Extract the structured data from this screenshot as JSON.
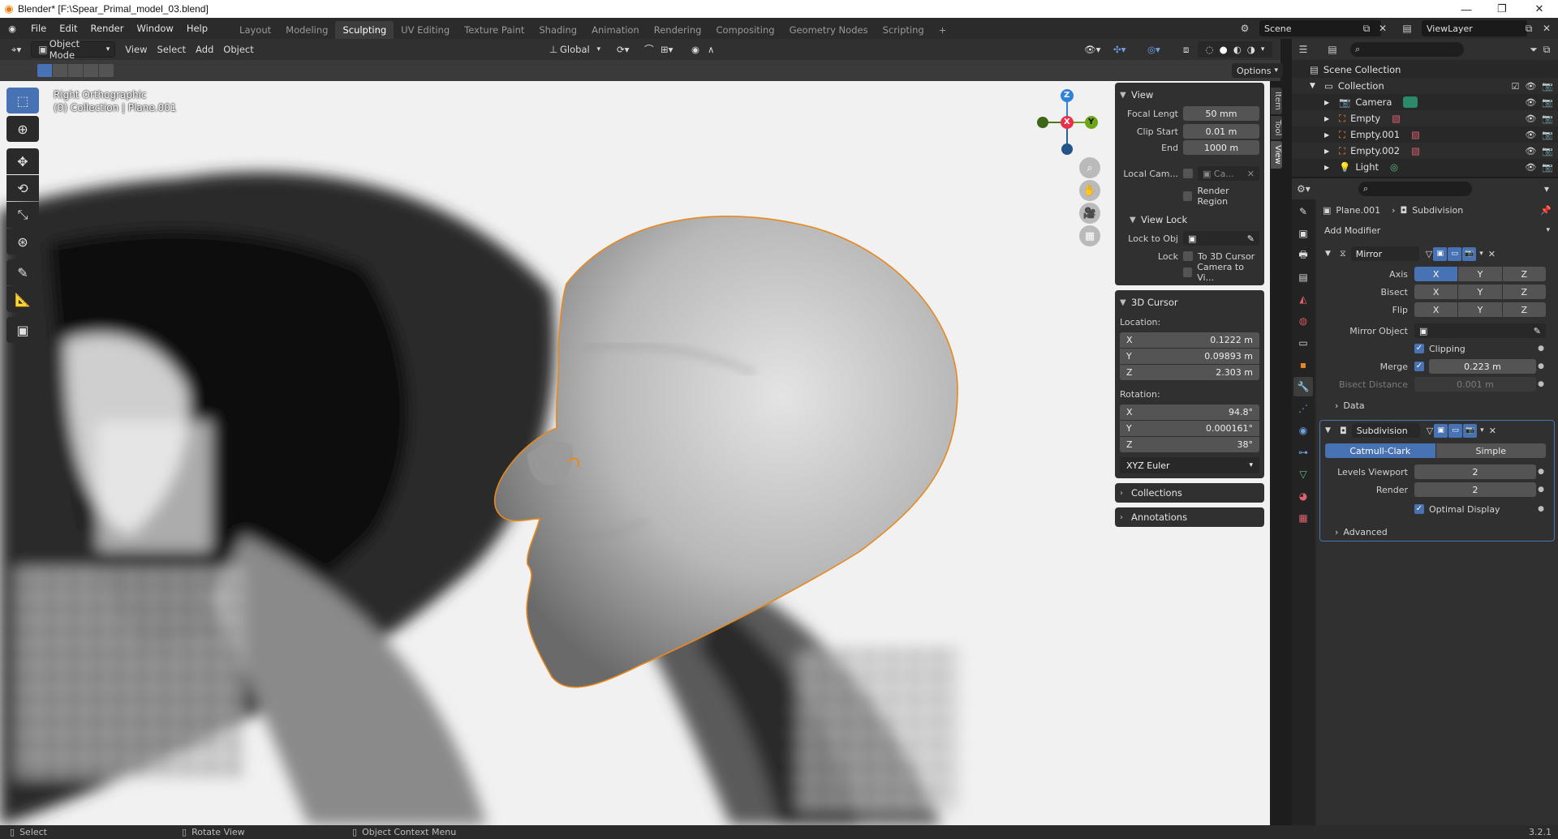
{
  "window": {
    "title": "Blender* [F:\\Spear_Primal_model_03.blend]"
  },
  "menu": [
    "File",
    "Edit",
    "Render",
    "Window",
    "Help"
  ],
  "workspaces": [
    "Layout",
    "Modeling",
    "Sculpting",
    "UV Editing",
    "Texture Paint",
    "Shading",
    "Animation",
    "Rendering",
    "Compositing",
    "Geometry Nodes",
    "Scripting"
  ],
  "active_workspace": "Sculpting",
  "scene": "Scene",
  "view_layer": "ViewLayer",
  "viewport_header": {
    "mode": "Object Mode",
    "menus": [
      "View",
      "Select",
      "Add",
      "Object"
    ],
    "transform_orientation": "Global",
    "options": "Options"
  },
  "viewport": {
    "view_name": "Right Orthographic",
    "collection_info": "(0) Collection | Plane.001"
  },
  "gizmo": {
    "x": "X",
    "y": "Y",
    "z": "Z"
  },
  "npanel": {
    "tabs": [
      "Item",
      "Tool",
      "View"
    ],
    "view": {
      "title": "View",
      "focal_length_label": "Focal Lengt",
      "focal_length": "50 mm",
      "clip_start_label": "Clip Start",
      "clip_start": "0.01 m",
      "clip_end_label": "End",
      "clip_end": "1000 m",
      "local_camera_label": "Local Cam...",
      "local_camera_value": "Ca...",
      "render_region": "Render Region"
    },
    "view_lock": {
      "title": "View Lock",
      "lock_to_obj_label": "Lock to Obj",
      "lock_label": "Lock",
      "to_3d_cursor": "To 3D Cursor",
      "camera_to_view": "Camera to Vi..."
    },
    "cursor": {
      "title": "3D Cursor",
      "location_label": "Location:",
      "loc_x": "0.1222 m",
      "loc_y": "0.09893 m",
      "loc_z": "2.303 m",
      "rotation_label": "Rotation:",
      "rot_x": "94.8°",
      "rot_y": "0.000161°",
      "rot_z": "38°",
      "rotation_mode": "XYZ Euler"
    },
    "collections": "Collections",
    "annotations": "Annotations"
  },
  "outliner": {
    "root": "Scene Collection",
    "collection": "Collection",
    "items": [
      "Camera",
      "Empty",
      "Empty.001",
      "Empty.002",
      "Light"
    ]
  },
  "properties": {
    "object": "Plane.001",
    "modifier_path": "Subdivision",
    "add_modifier": "Add Modifier",
    "mirror": {
      "name": "Mirror",
      "axis_label": "Axis",
      "bisect_label": "Bisect",
      "flip_label": "Flip",
      "x": "X",
      "y": "Y",
      "z": "Z",
      "mirror_object_label": "Mirror Object",
      "clipping": "Clipping",
      "merge_label": "Merge",
      "merge_value": "0.223 m",
      "bisect_distance_label": "Bisect Distance",
      "bisect_distance": "0.001 m",
      "data": "Data"
    },
    "subdivision": {
      "name": "Subdivision",
      "catmull": "Catmull-Clark",
      "simple": "Simple",
      "levels_viewport_label": "Levels Viewport",
      "levels_viewport": "2",
      "render_label": "Render",
      "render": "2",
      "optimal_display": "Optimal Display",
      "advanced": "Advanced"
    }
  },
  "status": {
    "select": "Select",
    "rotate": "Rotate View",
    "context": "Object Context Menu",
    "version": "3.2.1"
  },
  "colors": {
    "accent": "#4772b3",
    "selection_outline": "#e8891d",
    "axis_x": "#e8304b",
    "axis_y": "#6ca617",
    "axis_z": "#2f82d8"
  }
}
